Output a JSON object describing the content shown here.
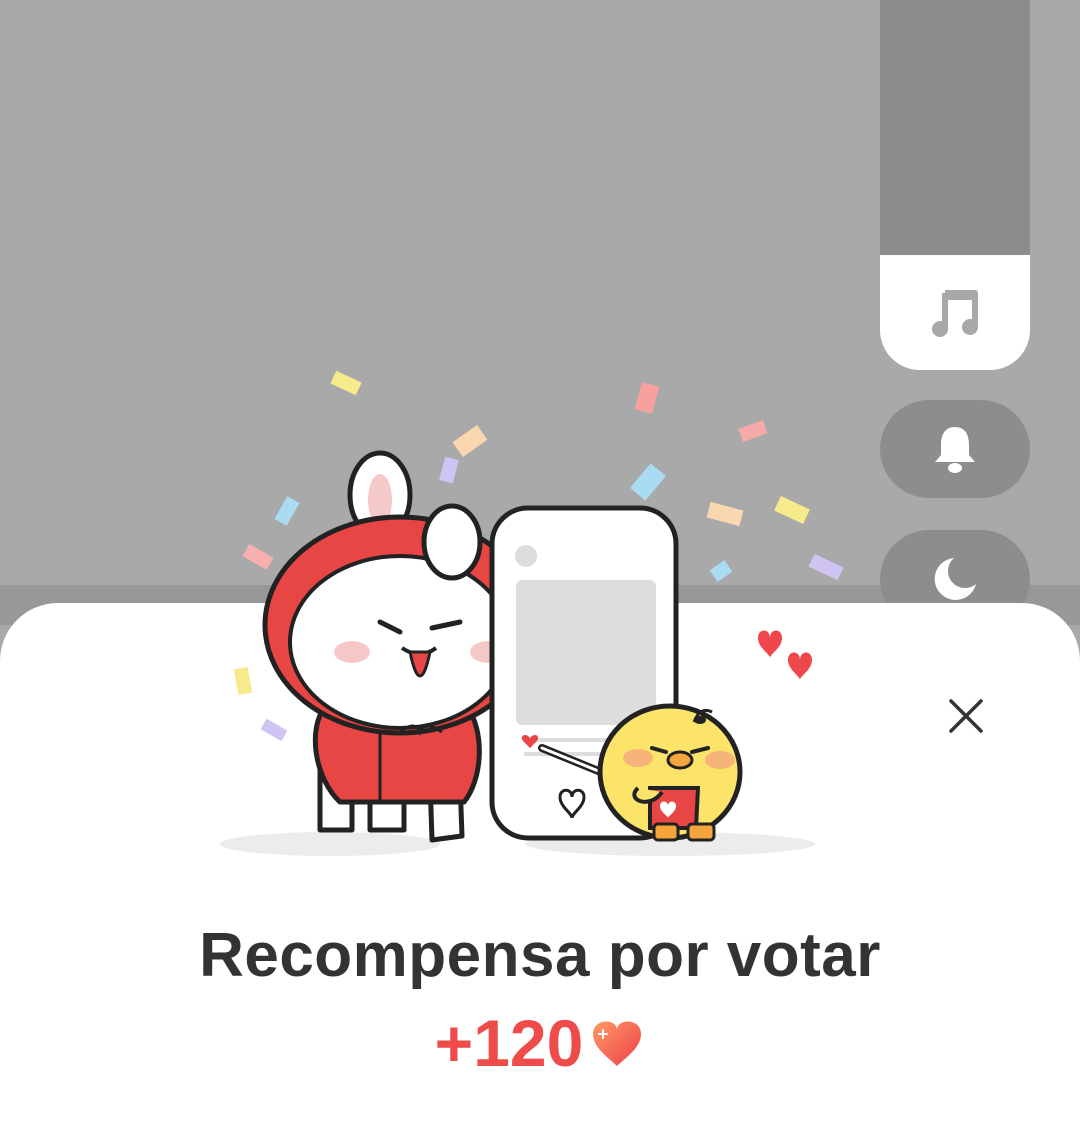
{
  "side_controls": {
    "items": [
      {
        "icon": "music-note-icon",
        "state": "active"
      },
      {
        "icon": "bell-icon",
        "state": "inactive"
      },
      {
        "icon": "moon-icon",
        "state": "inactive"
      }
    ]
  },
  "dialog": {
    "close_icon": "close-icon",
    "title": "Recompensa por votar",
    "reward_amount": "+120",
    "reward_icon": "heart-icon",
    "accent_color": "#ee4b4b"
  }
}
